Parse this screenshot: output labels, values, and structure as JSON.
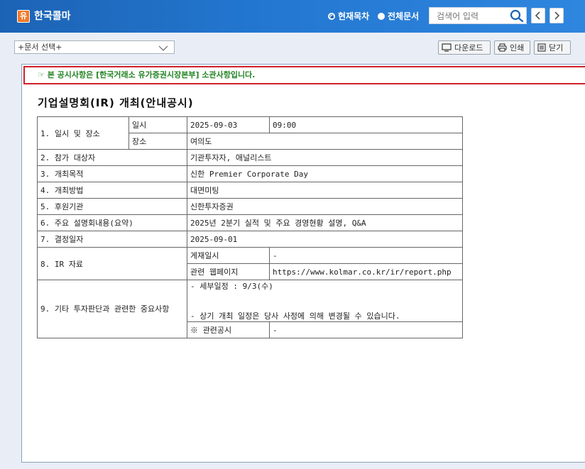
{
  "header": {
    "logo_char": "유",
    "company_name": "한국콜마",
    "scope_options": [
      {
        "label": "현재목차",
        "selected": true
      },
      {
        "label": "전체문서",
        "selected": false
      }
    ],
    "search_placeholder": "검색어 입력"
  },
  "toolbar": {
    "doc_select_value": "+문서 선택+",
    "download_label": "다운로드",
    "print_label": "인쇄",
    "close_label": "닫기"
  },
  "notice": {
    "text": "☞ 본 공시사항은 [한국거래소 유가증권시장본부] 소관사항입니다."
  },
  "document": {
    "title": "기업설명회(IR) 개최(안내공시)",
    "rows": {
      "r1_label": "1. 일시 및 장소",
      "r1_date_label": "일시",
      "r1_date": "2025-09-03",
      "r1_time": "09:00",
      "r1_place_label": "장소",
      "r1_place": "여의도",
      "r2_label": "2. 참가 대상자",
      "r2_value": "기관투자자, 애널리스트",
      "r3_label": "3. 개최목적",
      "r3_value": "신한 Premier Corporate Day",
      "r4_label": "4. 개최방법",
      "r4_value": "대면미팅",
      "r5_label": "5. 후원기관",
      "r5_value": "신한투자증권",
      "r6_label": "6. 주요 설명회내용(요약)",
      "r6_value": "2025년 2분기 실적 및 주요 경영현황 설명, Q&A",
      "r7_label": "7. 결정일자",
      "r7_value": "2025-09-01",
      "r8_label": "8. IR 자료",
      "r8_post_label": "게재일시",
      "r8_post_value": "-",
      "r8_web_label": "관련 웹페이지",
      "r8_web_value": "https://www.kolmar.co.kr/ir/report.php",
      "r9_label": "9. 기타 투자판단과 관련한 중요사항",
      "r9_line1": "- 세부일정 : 9/3(수)",
      "r9_line2": "- 상기 개최 일정은 당사 사정에 의해 변경될 수 있습니다.",
      "r9_related_label": "※ 관련공시",
      "r9_related_value": "-"
    }
  },
  "colors": {
    "header_blue": "#2377d0",
    "notice_border": "#d1202a",
    "notice_text": "#238423",
    "logo_orange": "#f07a2a"
  }
}
